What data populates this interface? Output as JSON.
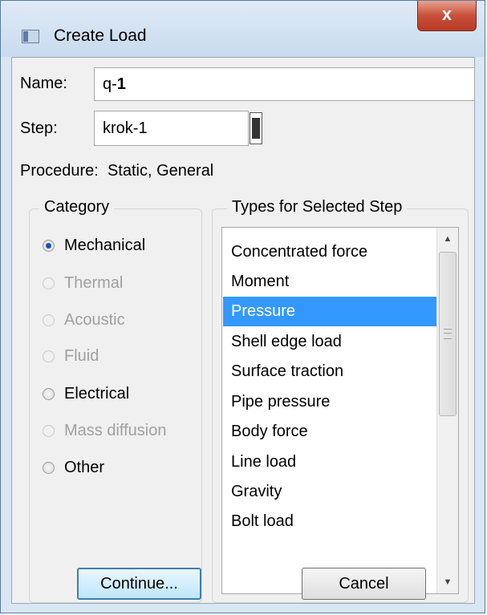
{
  "window": {
    "title": "Create Load",
    "close_label": "x"
  },
  "form": {
    "name_label": "Name:",
    "name_value_prefix": "q-",
    "name_value_suffix": "1",
    "step_label": "Step:",
    "step_value": "krok-1",
    "procedure_label": "Procedure:",
    "procedure_value": "Static, General"
  },
  "category": {
    "title": "Category",
    "options": [
      {
        "label": "Mechanical",
        "selected": true,
        "enabled": true
      },
      {
        "label": "Thermal",
        "selected": false,
        "enabled": false
      },
      {
        "label": "Acoustic",
        "selected": false,
        "enabled": false
      },
      {
        "label": "Fluid",
        "selected": false,
        "enabled": false
      },
      {
        "label": "Electrical",
        "selected": false,
        "enabled": true
      },
      {
        "label": "Mass diffusion",
        "selected": false,
        "enabled": false
      },
      {
        "label": "Other",
        "selected": false,
        "enabled": true
      }
    ]
  },
  "types": {
    "title": "Types for Selected Step",
    "items": [
      "Concentrated force",
      "Moment",
      "Pressure",
      "Shell edge load",
      "Surface traction",
      "Pipe pressure",
      "Body force",
      "Line load",
      "Gravity",
      "Bolt load"
    ],
    "selected": "Pressure"
  },
  "buttons": {
    "continue_label": "Continue...",
    "cancel_label": "Cancel"
  },
  "colors": {
    "selection": "#3399ff",
    "window_frame": "#d9e6f4",
    "close_button": "#c8503a"
  }
}
